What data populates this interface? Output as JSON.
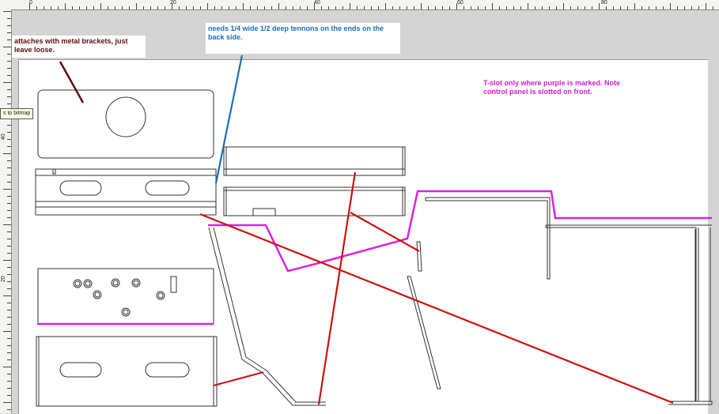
{
  "rulers": {
    "top_labels": [
      "0",
      "20",
      "40",
      "60",
      "80"
    ],
    "left_labels": [
      "40",
      "20"
    ]
  },
  "tooltip": {
    "text": "s to bitmap"
  },
  "annotations": {
    "brackets_note": "attaches with metal brackets, just leave loose.",
    "tenons_note": "needs 1/4 wide 1/2 deep tennons on the ends on the back side.",
    "tslot_note": "T-slot only where purple is marked. Note control panel is slotted on front."
  },
  "colors": {
    "note_dark_red": "#5b0d0d",
    "note_blue": "#1d6fb8",
    "note_magenta": "#cc22cc",
    "leader_red": "#cc1111",
    "tslot_purple": "#dd22dd",
    "outline": "#333333"
  }
}
